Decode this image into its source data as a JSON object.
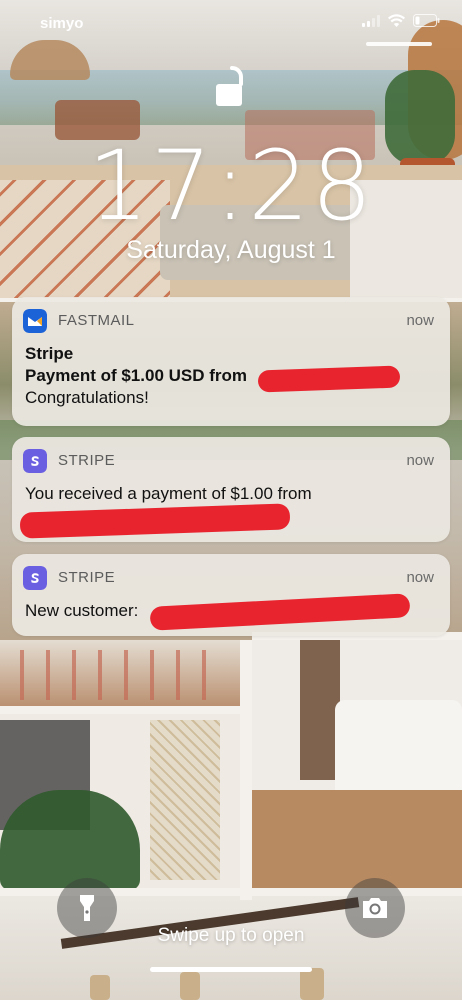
{
  "status_bar": {
    "carrier": "simyo",
    "icons": [
      "signal-icon",
      "wifi-icon",
      "battery-icon"
    ]
  },
  "lock_screen": {
    "lock_icon": "unlocked-padlock-icon",
    "time": "17:28",
    "date": "Saturday, August 1"
  },
  "notifications": [
    {
      "app": "FASTMAIL",
      "icon": "fastmail-icon",
      "time": "now",
      "title": "Stripe",
      "subtitle": "Payment of $1.00 USD from",
      "body": "Congratulations!"
    },
    {
      "app": "STRIPE",
      "icon": "stripe-icon",
      "time": "now",
      "body": "You received a payment of $1.00 from"
    },
    {
      "app": "STRIPE",
      "icon": "stripe-icon",
      "time": "now",
      "body": "New customer:"
    }
  ],
  "quick_actions": {
    "left": "flashlight-icon",
    "right": "camera-icon"
  },
  "swipe_hint": "Swipe up to open",
  "colors": {
    "fastmail_blue": "#1d63d8",
    "stripe_purple": "#6a5fe0",
    "redaction_red": "#e8242f"
  }
}
